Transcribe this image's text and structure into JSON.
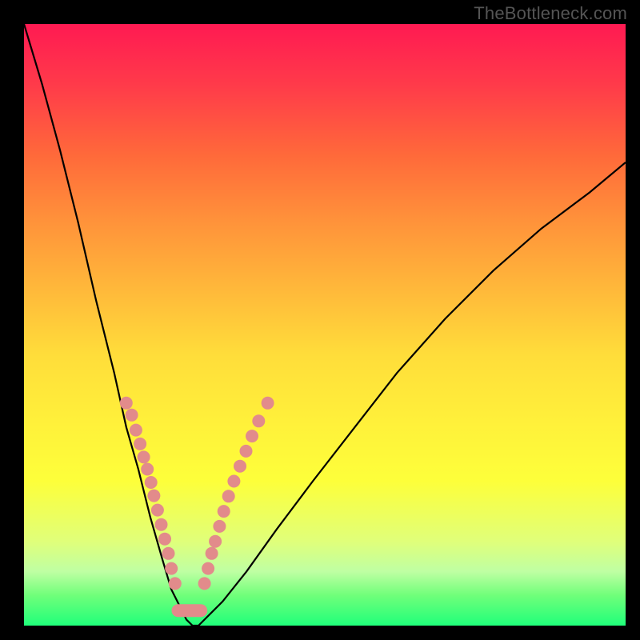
{
  "watermark": "TheBottleneck.com",
  "gradient_colors": {
    "top": "#ff1a52",
    "mid_upper": "#ff933a",
    "mid": "#ffdd3a",
    "mid_lower": "#fdff3a",
    "bottom": "#20ff7a"
  },
  "chart_data": {
    "type": "line",
    "title": "",
    "xlabel": "",
    "ylabel": "",
    "xlim": [
      0,
      100
    ],
    "ylim": [
      0,
      100
    ],
    "grid": false,
    "annotations": [
      "TheBottleneck.com"
    ],
    "series": [
      {
        "name": "bottleneck-curve",
        "x": [
          0,
          3,
          6,
          9,
          12,
          15,
          17,
          19,
          21,
          23,
          24.5,
          26,
          27,
          28,
          29,
          30,
          33,
          37,
          42,
          48,
          55,
          62,
          70,
          78,
          86,
          94,
          100
        ],
        "y": [
          100,
          90,
          79,
          67,
          54,
          42,
          33,
          26,
          18,
          11,
          6,
          3,
          1,
          0,
          0,
          1,
          4,
          9,
          16,
          24,
          33,
          42,
          51,
          59,
          66,
          72,
          77
        ]
      }
    ],
    "highlight_points_left_branch": [
      {
        "x": 17.0,
        "y_pct": 63
      },
      {
        "x": 17.9,
        "y_pct": 65
      },
      {
        "x": 18.6,
        "y_pct": 67.5
      },
      {
        "x": 19.3,
        "y_pct": 69.8
      },
      {
        "x": 19.9,
        "y_pct": 72.0
      },
      {
        "x": 20.5,
        "y_pct": 74.0
      },
      {
        "x": 21.1,
        "y_pct": 76.2
      },
      {
        "x": 21.6,
        "y_pct": 78.4
      },
      {
        "x": 22.2,
        "y_pct": 80.8
      },
      {
        "x": 22.8,
        "y_pct": 83.2
      },
      {
        "x": 23.4,
        "y_pct": 85.6
      },
      {
        "x": 24.0,
        "y_pct": 88.0
      },
      {
        "x": 24.5,
        "y_pct": 90.5
      },
      {
        "x": 25.1,
        "y_pct": 93.0
      }
    ],
    "highlight_points_right_branch": [
      {
        "x": 30.0,
        "y_pct": 93.0
      },
      {
        "x": 30.6,
        "y_pct": 90.5
      },
      {
        "x": 31.2,
        "y_pct": 88.0
      },
      {
        "x": 31.8,
        "y_pct": 86.0
      },
      {
        "x": 32.5,
        "y_pct": 83.5
      },
      {
        "x": 33.2,
        "y_pct": 81.0
      },
      {
        "x": 34.0,
        "y_pct": 78.5
      },
      {
        "x": 34.9,
        "y_pct": 76.0
      },
      {
        "x": 35.9,
        "y_pct": 73.5
      },
      {
        "x": 36.9,
        "y_pct": 71.0
      },
      {
        "x": 37.9,
        "y_pct": 68.5
      },
      {
        "x": 39.0,
        "y_pct": 66.0
      },
      {
        "x": 40.5,
        "y_pct": 63.0
      }
    ],
    "valley_segment": {
      "x_start": 25.6,
      "x_end": 29.4,
      "y_pct": 97.5
    }
  }
}
